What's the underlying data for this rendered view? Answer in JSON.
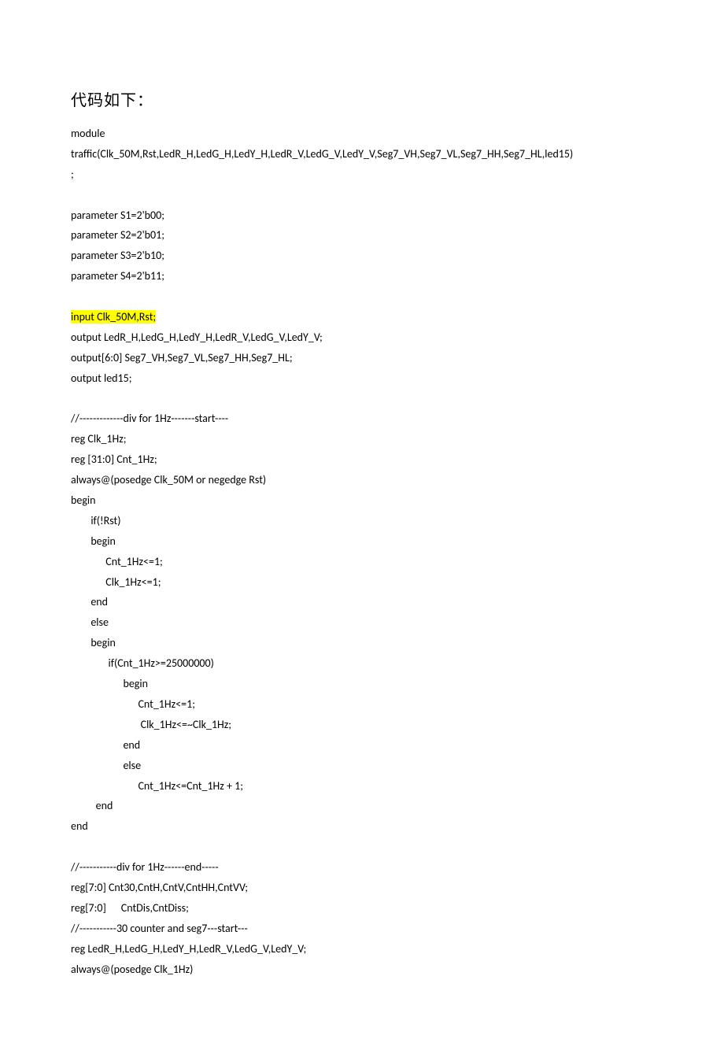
{
  "heading": "代码如下：",
  "lines": [
    "module",
    "traffic(Clk_50M,Rst,LedR_H,LedG_H,LedY_H,LedR_V,LedG_V,LedY_V,Seg7_VH,Seg7_VL,Seg7_HH,Seg7_HL,led15)",
    ";",
    "",
    "parameter S1=2'b00;",
    "parameter S2=2'b01;",
    "parameter S3=2'b10;",
    "parameter S4=2'b11;",
    "",
    "input Clk_50M,Rst;",
    "output LedR_H,LedG_H,LedY_H,LedR_V,LedG_V,LedY_V;",
    "output[6:0] Seg7_VH,Seg7_VL,Seg7_HH,Seg7_HL;",
    "output led15;",
    "",
    "//-------------div for 1Hz-------start----",
    "reg Clk_1Hz;",
    "reg [31:0] Cnt_1Hz;",
    "always@(posedge Clk_50M or negedge Rst)",
    "begin",
    "        if(!Rst)",
    "        begin",
    "              Cnt_1Hz<=1;",
    "              Clk_1Hz<=1;",
    "        end",
    "        else",
    "        begin",
    "               if(Cnt_1Hz>=25000000)",
    "                     begin",
    "                           Cnt_1Hz<=1;",
    "                            Clk_1Hz<=~Clk_1Hz;",
    "                     end",
    "                     else",
    "                           Cnt_1Hz<=Cnt_1Hz + 1;",
    "          end",
    "end",
    "",
    "//-----------div for 1Hz------end-----",
    "reg[7:0] Cnt30,CntH,CntV,CntHH,CntVV;",
    "reg[7:0]      CntDis,CntDiss;",
    "//-----------30 counter and seg7---start---",
    "reg LedR_H,LedG_H,LedY_H,LedR_V,LedG_V,LedY_V;",
    "always@(posedge Clk_1Hz)"
  ],
  "highlight_index": 9
}
